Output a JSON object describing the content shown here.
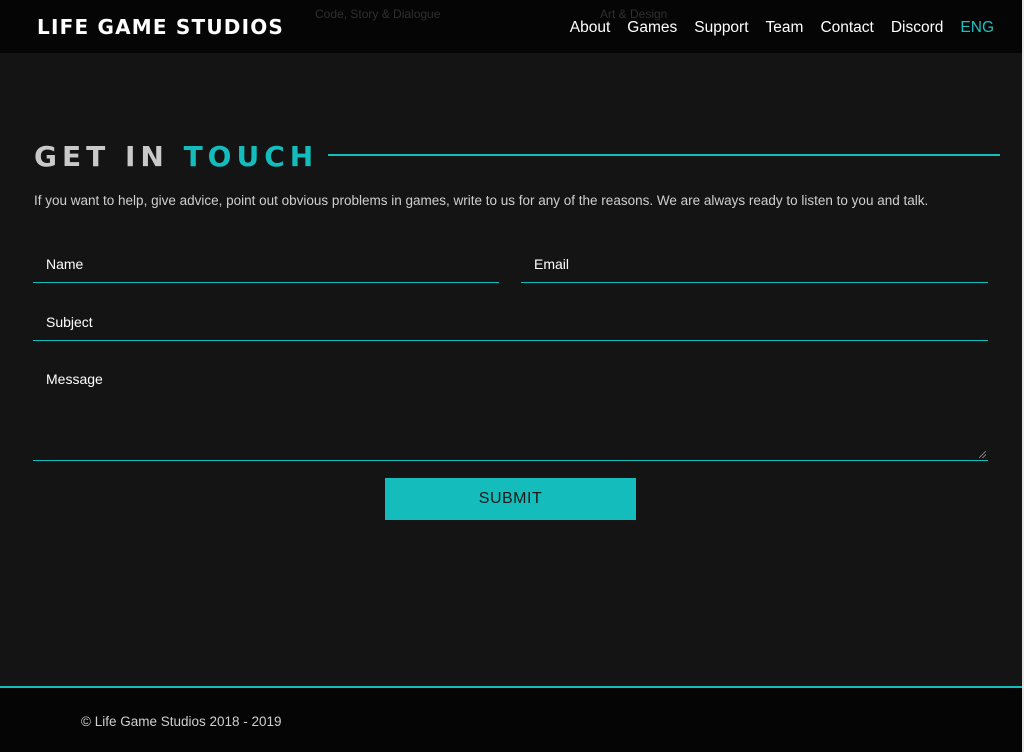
{
  "header": {
    "logo": "LIFE GAME STUDIOS",
    "ghost_left": "Code, Story & Dialogue",
    "ghost_right": "Art & Design",
    "nav": [
      "About",
      "Games",
      "Support",
      "Team",
      "Contact",
      "Discord",
      "ENG"
    ],
    "active_nav": "ENG"
  },
  "main": {
    "title_part1": "GET IN",
    "title_part2": "TOUCH",
    "intro": "If you want to help, give advice, point out obvious problems in games, write to us for any of the reasons. We are always ready to listen to you and talk.",
    "form": {
      "name_placeholder": "Name",
      "email_placeholder": "Email",
      "subject_placeholder": "Subject",
      "message_placeholder": "Message",
      "submit_label": "SUBMIT"
    }
  },
  "footer": {
    "copyright": "© Life Game Studios 2018 - 2019"
  },
  "colors": {
    "accent": "#14bcbc",
    "background": "#141414",
    "header_bg": "#050505"
  }
}
